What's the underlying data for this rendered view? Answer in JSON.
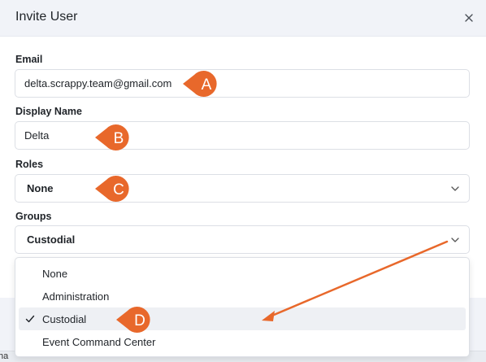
{
  "dialog": {
    "title": "Invite User"
  },
  "email": {
    "label": "Email",
    "value": "delta.scrappy.team@gmail.com"
  },
  "display_name": {
    "label": "Display Name",
    "value": "Delta"
  },
  "roles": {
    "label": "Roles",
    "selected": "None"
  },
  "groups": {
    "label": "Groups",
    "selected": "Custodial",
    "options": [
      "None",
      "Administration",
      "Custodial",
      "Event Command Center"
    ]
  },
  "footer": {
    "peek_text": "ha"
  },
  "annotations": {
    "a": "A",
    "b": "B",
    "c": "C",
    "d": "D"
  },
  "colors": {
    "annotation": "#e8682b",
    "header_bg": "#f1f3f8",
    "border": "#dcdfe5",
    "selected_bg": "#eef0f4"
  }
}
